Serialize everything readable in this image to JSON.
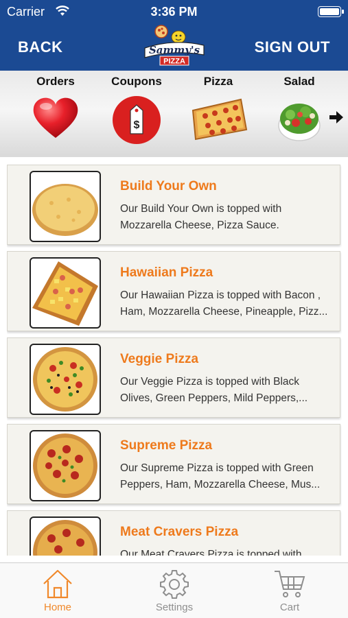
{
  "status_bar": {
    "carrier": "Carrier",
    "time": "3:36 PM"
  },
  "header": {
    "back_label": "BACK",
    "signout_label": "SIGN OUT",
    "logo_text": "Sammy's PIZZA"
  },
  "categories": [
    {
      "label": "Orders",
      "icon": "heart-icon"
    },
    {
      "label": "Coupons",
      "icon": "price-tag-icon"
    },
    {
      "label": "Pizza",
      "icon": "pizza-slice-image"
    },
    {
      "label": "Salad",
      "icon": "salad-bowl-image"
    }
  ],
  "menu_items": [
    {
      "title": "Build Your Own",
      "description": "Our Build Your Own is topped with\nMozzarella Cheese, Pizza Sauce."
    },
    {
      "title": "Hawaiian Pizza",
      "description": "Our Hawaiian Pizza is topped with Bacon ,\nHam, Mozzarella Cheese, Pineapple, Pizz..."
    },
    {
      "title": "Veggie Pizza",
      "description": "Our Veggie Pizza is topped with Black\nOlives, Green Peppers, Mild Peppers,..."
    },
    {
      "title": "Supreme Pizza",
      "description": "Our Supreme Pizza is topped with Green\nPeppers, Ham, Mozzarella Cheese, Mus..."
    },
    {
      "title": "Meat Cravers Pizza",
      "description": "Our Meat Cravers Pizza is topped with"
    }
  ],
  "tabs": [
    {
      "label": "Home",
      "icon": "home-icon",
      "active": true
    },
    {
      "label": "Settings",
      "icon": "gear-icon",
      "active": false
    },
    {
      "label": "Cart",
      "icon": "cart-icon",
      "active": false
    }
  ],
  "colors": {
    "header_bg": "#1b4a93",
    "accent_orange": "#ee7a1c",
    "tab_active": "#f0882a",
    "tab_inactive": "#8e8e8e"
  }
}
